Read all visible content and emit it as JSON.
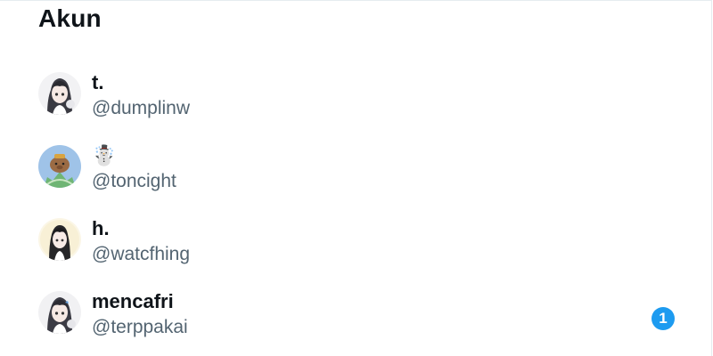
{
  "section": {
    "title": "Akun"
  },
  "accounts": [
    {
      "name": "t.",
      "handle": "@dumplinw",
      "avatar": "anime-girl-avatar-icon"
    },
    {
      "name": "☃️",
      "handle": "@toncight",
      "avatar": "capybara-avatar-icon"
    },
    {
      "name": "h.",
      "handle": "@watcfhing",
      "avatar": "anime-girl-avatar-icon"
    },
    {
      "name": "mencafri",
      "handle": "@terppakai",
      "avatar": "anime-girl-avatar-icon",
      "badge": "1"
    }
  ],
  "colors": {
    "accent": "#1d9bf0",
    "secondary_text": "#536471",
    "primary_text": "#0f1419"
  }
}
